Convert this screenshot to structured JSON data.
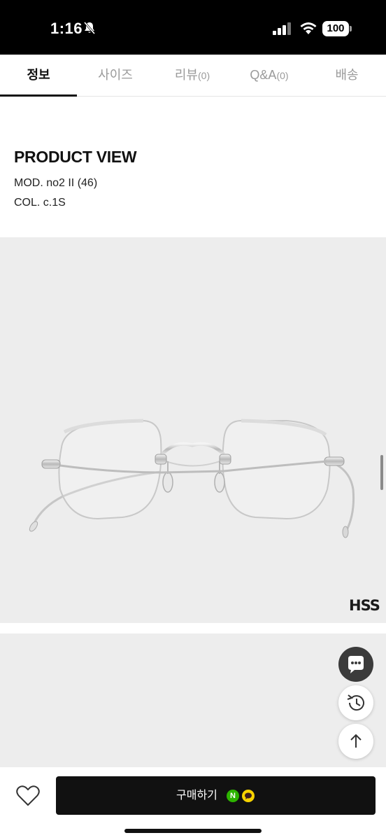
{
  "status_bar": {
    "time": "1:16",
    "battery": "100",
    "icons": [
      "bell-slash-icon",
      "signal-icon",
      "wifi-icon",
      "battery-icon"
    ]
  },
  "tabs": [
    {
      "label": "정보",
      "count": "",
      "active": true
    },
    {
      "label": "사이즈",
      "count": "",
      "active": false
    },
    {
      "label": "리뷰",
      "count": "(0)",
      "active": false
    },
    {
      "label": "Q&A",
      "count": "(0)",
      "active": false
    },
    {
      "label": "배송",
      "count": "",
      "active": false
    }
  ],
  "product_view": {
    "title": "PRODUCT VIEW",
    "model": "MOD. no2 II (46)",
    "color": "COL. c.1S"
  },
  "product_image": {
    "brand_logo": "HSS",
    "subject": "glasses"
  },
  "floating_buttons": [
    "chat-icon",
    "history-icon",
    "arrow-up-icon"
  ],
  "bottom_bar": {
    "wishlist_icon": "heart-icon",
    "buy_label": "구매하기",
    "naver_badge": "N",
    "kakao_badge": "kakao-talk-icon"
  },
  "colors": {
    "accent": "#111111",
    "naver": "#2db400",
    "kakao": "#f7d300",
    "image_background": "#ededed"
  }
}
